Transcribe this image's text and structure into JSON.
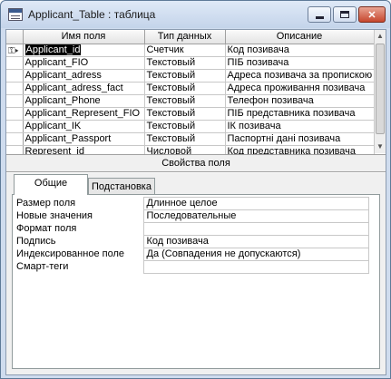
{
  "window": {
    "title": "Applicant_Table : таблица"
  },
  "grid": {
    "columns": [
      "Имя поля",
      "Тип данных",
      "Описание"
    ],
    "rows": [
      {
        "name": "Applicant_id",
        "type": "Счетчик",
        "desc": "Код позивача",
        "key": true,
        "selected": true
      },
      {
        "name": "Applicant_FIO",
        "type": "Текстовый",
        "desc": "ПІБ позивача"
      },
      {
        "name": "Applicant_adress",
        "type": "Текстовый",
        "desc": "Адреса позивача за пропискою"
      },
      {
        "name": "Applicant_adress_fact",
        "type": "Текстовый",
        "desc": "Адреса проживання позивача"
      },
      {
        "name": "Applicant_Phone",
        "type": "Текстовый",
        "desc": "Телефон позивача"
      },
      {
        "name": "Applicant_Represent_FIO",
        "type": "Текстовый",
        "desc": "ПІБ представника позивача"
      },
      {
        "name": "Applicant_IK",
        "type": "Текстовый",
        "desc": "ІК позивача"
      },
      {
        "name": "Applicant_Passport",
        "type": "Текстовый",
        "desc": "Паспортні дані позивача"
      },
      {
        "name": "Represent_id",
        "type": "Числовой",
        "desc": "Код представника позивача"
      },
      {
        "name": "",
        "type": "",
        "desc": ""
      }
    ]
  },
  "properties_caption": "Свойства поля",
  "tabs": {
    "general": "Общие",
    "lookup": "Подстановка"
  },
  "properties": [
    {
      "label": "Размер поля",
      "value": "Длинное целое"
    },
    {
      "label": "Новые значения",
      "value": "Последовательные"
    },
    {
      "label": "Формат поля",
      "value": ""
    },
    {
      "label": "Подпись",
      "value": "Код позивача"
    },
    {
      "label": "Индексированное поле",
      "value": "Да (Совпадения не допускаются)"
    },
    {
      "label": "Смарт-теги",
      "value": ""
    }
  ]
}
